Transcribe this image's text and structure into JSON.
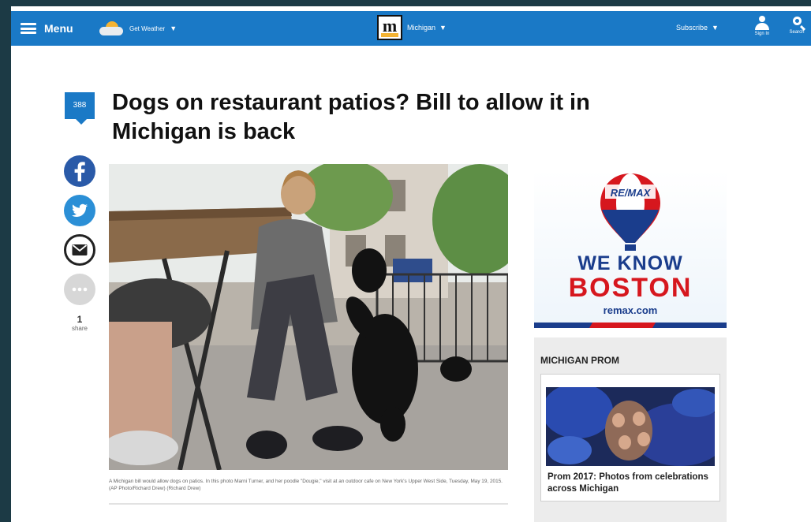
{
  "header": {
    "menu_label": "Menu",
    "weather_label": "Get Weather",
    "region_label": "Michigan",
    "subscribe_label": "Subscribe",
    "signin_label": "Sign In",
    "search_label": "Search",
    "logo_letter": "m"
  },
  "article": {
    "comment_count": "388",
    "headline": "Dogs on restaurant patios? Bill to allow it in Michigan is back",
    "share_count": "1",
    "share_label": "share",
    "caption": "A Michigan bill would allow dogs on patios. In this photo Marni Turner, and her poodle \"Dougie,\" visit at an outdoor cafe on New York's Upper West Side, Tuesday, May 19, 2015. (AP Photo/Richard Drew) (Richard Drew)"
  },
  "ad": {
    "balloon_text": "RE/MAX",
    "line1": "WE KNOW",
    "line2": "BOSTON",
    "url": "remax.com"
  },
  "module": {
    "title": "MICHIGAN PROM",
    "card_title": "Prom 2017: Photos from celebrations across Michigan"
  },
  "colors": {
    "nav_blue": "#1a79c6",
    "facebook": "#2a5aa8",
    "twitter": "#2b8fd6",
    "remax_blue": "#1a3d8c",
    "remax_red": "#d6171e"
  },
  "icons": [
    "hamburger-icon",
    "weather-icon",
    "chevron-down-icon",
    "user-icon",
    "search-icon",
    "comment-icon",
    "facebook-icon",
    "twitter-icon",
    "email-icon",
    "more-icon"
  ]
}
